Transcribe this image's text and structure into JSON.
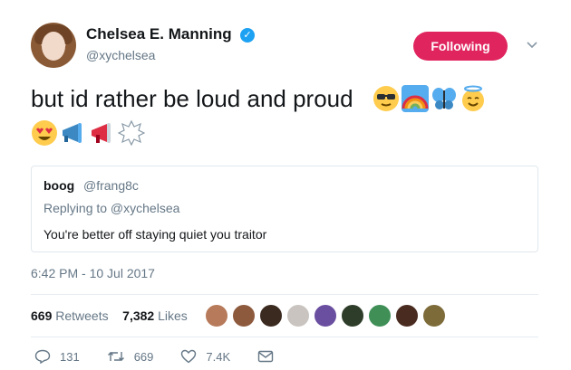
{
  "user": {
    "name": "Chelsea E. Manning",
    "handle": "@xychelsea",
    "verified": true
  },
  "follow_button": {
    "label": "Following",
    "color": "#e0245e"
  },
  "tweet": {
    "text": "but id rather be loud and proud",
    "emojis": [
      "sunglasses-face-icon",
      "rainbow-icon",
      "butterfly-icon",
      "halo-smile-icon",
      "heart-eyes-icon",
      "megaphone-blue-icon",
      "megaphone-red-icon",
      "anger-bubble-icon"
    ],
    "timestamp": "6:42 PM - 10 Jul 2017"
  },
  "quote": {
    "name": "boog",
    "handle": "@frang8c",
    "replying_to": "Replying to @xychelsea",
    "text": "You're better off staying quiet you traitor"
  },
  "stats": {
    "retweets_count": "669",
    "retweets_label": "Retweets",
    "likes_count": "7,382",
    "likes_label": "Likes"
  },
  "actions": {
    "reply_count": "131",
    "retweet_count": "669",
    "like_count": "7.4K"
  },
  "colors": {
    "accent": "#1da1f2",
    "muted": "#657786",
    "border": "#e1e8ed"
  }
}
